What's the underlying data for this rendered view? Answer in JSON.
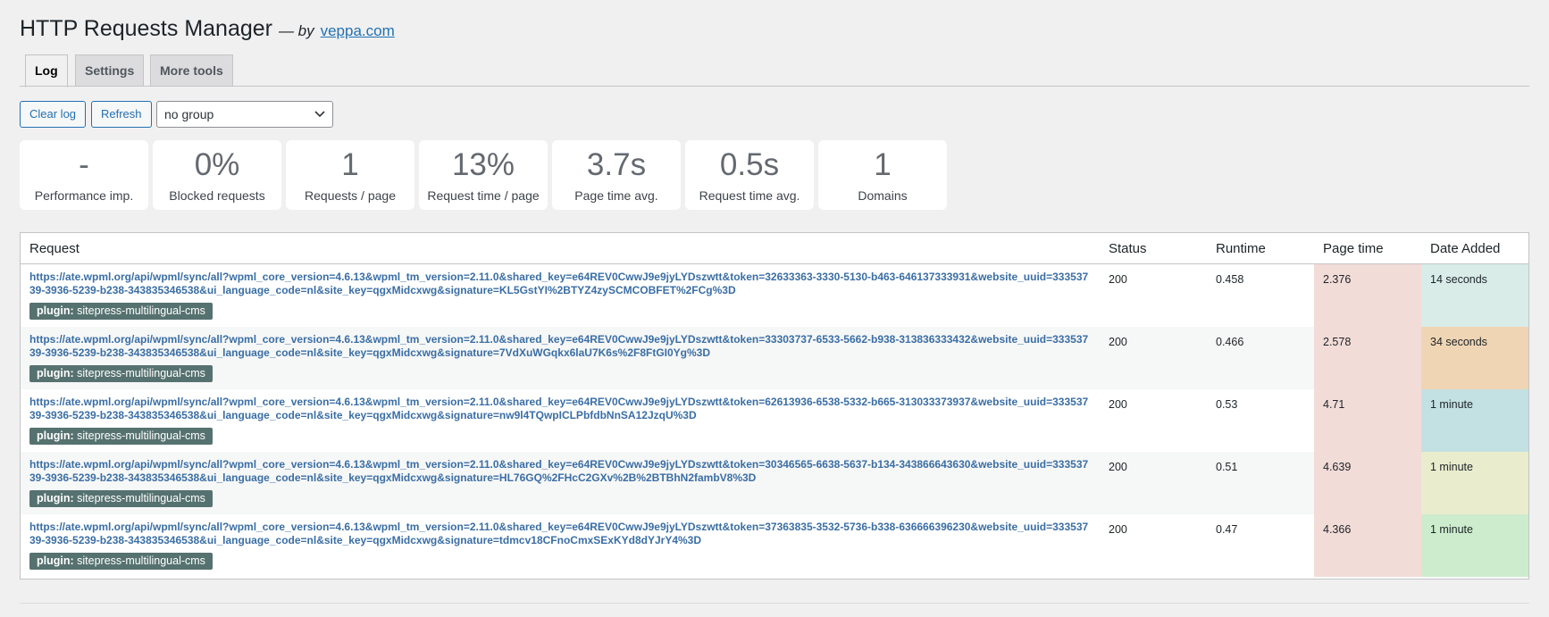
{
  "header": {
    "title": "HTTP Requests Manager",
    "by_text": "— by",
    "author_link": "veppa.com"
  },
  "tabs": [
    {
      "label": "Log",
      "active": true
    },
    {
      "label": "Settings",
      "active": false
    },
    {
      "label": "More tools",
      "active": false
    }
  ],
  "toolbar": {
    "clear_label": "Clear log",
    "refresh_label": "Refresh",
    "group_value": "no group"
  },
  "stats": [
    {
      "value": "-",
      "label": "Performance imp."
    },
    {
      "value": "0%",
      "label": "Blocked requests"
    },
    {
      "value": "1",
      "label": "Requests / page"
    },
    {
      "value": "13%",
      "label": "Request time / page"
    },
    {
      "value": "3.7s",
      "label": "Page time avg."
    },
    {
      "value": "0.5s",
      "label": "Request time avg."
    },
    {
      "value": "1",
      "label": "Domains"
    }
  ],
  "table": {
    "columns": [
      "Request",
      "Status",
      "Runtime",
      "Page time",
      "Date Added"
    ],
    "tag_key": "plugin:",
    "rows": [
      {
        "url": "https://ate.wpml.org/api/wpml/sync/all?wpml_core_version=4.6.13&wpml_tm_version=2.11.0&shared_key=e64REV0CwwJ9e9jyLYDszwtt&token=32633363-3330-5130-b463-646137333931&website_uuid=33353739-3936-5239-b238-343835346538&ui_language_code=nl&site_key=qgxMidcxwg&signature=KL5GstYI%2BTYZ4zySCMCOBFET%2FCg%3D",
        "tag": "sitepress-multilingual-cms",
        "status": "200",
        "runtime": "0.458",
        "page_time": "2.376",
        "date_added": "14 seconds",
        "date_color": "#d9ece8"
      },
      {
        "url": "https://ate.wpml.org/api/wpml/sync/all?wpml_core_version=4.6.13&wpml_tm_version=2.11.0&shared_key=e64REV0CwwJ9e9jyLYDszwtt&token=33303737-6533-5662-b938-313836333432&website_uuid=33353739-3936-5239-b238-343835346538&ui_language_code=nl&site_key=qgxMidcxwg&signature=7VdXuWGqkx6laU7K6s%2F8FtGI0Yg%3D",
        "tag": "sitepress-multilingual-cms",
        "status": "200",
        "runtime": "0.466",
        "page_time": "2.578",
        "date_added": "34 seconds",
        "date_color": "#efd5b4"
      },
      {
        "url": "https://ate.wpml.org/api/wpml/sync/all?wpml_core_version=4.6.13&wpml_tm_version=2.11.0&shared_key=e64REV0CwwJ9e9jyLYDszwtt&token=62613936-6538-5332-b665-313033373937&website_uuid=33353739-3936-5239-b238-343835346538&ui_language_code=nl&site_key=qgxMidcxwg&signature=nw9l4TQwpICLPbfdbNnSA12JzqU%3D",
        "tag": "sitepress-multilingual-cms",
        "status": "200",
        "runtime": "0.53",
        "page_time": "4.71",
        "date_added": "1 minute",
        "date_color": "#c3e0e2"
      },
      {
        "url": "https://ate.wpml.org/api/wpml/sync/all?wpml_core_version=4.6.13&wpml_tm_version=2.11.0&shared_key=e64REV0CwwJ9e9jyLYDszwtt&token=30346565-6638-5637-b134-343866643630&website_uuid=33353739-3936-5239-b238-343835346538&ui_language_code=nl&site_key=qgxMidcxwg&signature=HL76GQ%2FHcC2GXv%2B%2BTBhN2fambV8%3D",
        "tag": "sitepress-multilingual-cms",
        "status": "200",
        "runtime": "0.51",
        "page_time": "4.639",
        "date_added": "1 minute",
        "date_color": "#e9eccd"
      },
      {
        "url": "https://ate.wpml.org/api/wpml/sync/all?wpml_core_version=4.6.13&wpml_tm_version=2.11.0&shared_key=e64REV0CwwJ9e9jyLYDszwtt&token=37363835-3532-5736-b338-636666396230&website_uuid=33353739-3936-5239-b238-343835346538&ui_language_code=nl&site_key=qgxMidcxwg&signature=tdmcv18CFnoCmxSExKYd8dYJrY4%3D",
        "tag": "sitepress-multilingual-cms",
        "status": "200",
        "runtime": "0.47",
        "page_time": "4.366",
        "date_added": "1 minute",
        "date_color": "#cdeccd"
      }
    ]
  },
  "colors": {
    "page_time_bg": "#f2dcd8",
    "page_time_bg_alt": "#eed6d2",
    "tag_bg": "#567270",
    "link": "#3a6ea5"
  }
}
